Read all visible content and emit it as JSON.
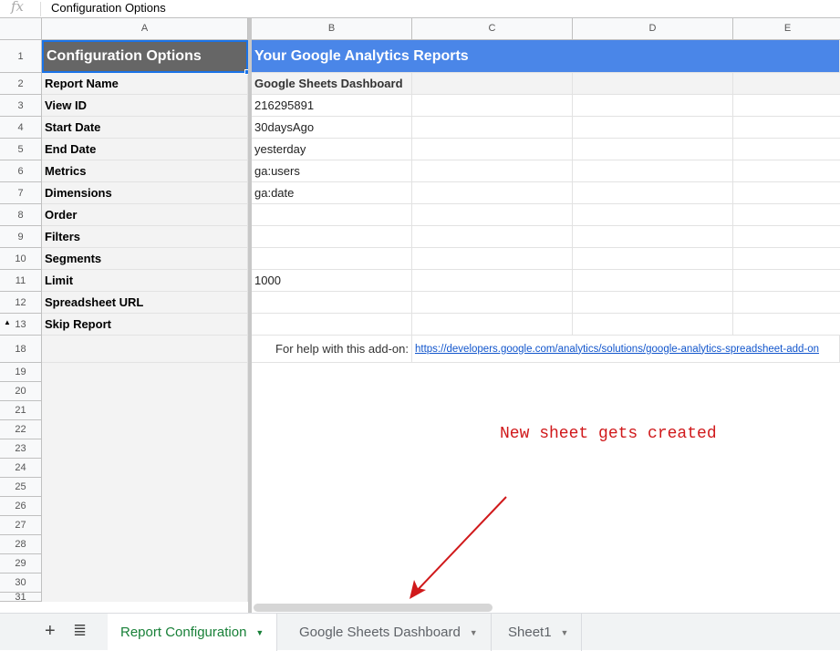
{
  "formula_bar": {
    "fx_label": "fx",
    "value": "Configuration Options"
  },
  "columns": [
    "A",
    "B",
    "C",
    "D",
    "E"
  ],
  "rows": [
    {
      "num": "1",
      "a": "Configuration Options",
      "b": "Your Google Analytics Reports"
    },
    {
      "num": "2",
      "a": "Report Name",
      "b": "Google Sheets Dashboard"
    },
    {
      "num": "3",
      "a": "View ID",
      "b": "216295891"
    },
    {
      "num": "4",
      "a": "Start Date",
      "b": "30daysAgo"
    },
    {
      "num": "5",
      "a": "End Date",
      "b": "yesterday"
    },
    {
      "num": "6",
      "a": "Metrics",
      "b": "ga:users"
    },
    {
      "num": "7",
      "a": "Dimensions",
      "b": "ga:date"
    },
    {
      "num": "8",
      "a": "Order",
      "b": ""
    },
    {
      "num": "9",
      "a": "Filters",
      "b": ""
    },
    {
      "num": "10",
      "a": "Segments",
      "b": ""
    },
    {
      "num": "11",
      "a": "Limit",
      "b": "1000"
    },
    {
      "num": "12",
      "a": "Spreadsheet URL",
      "b": ""
    },
    {
      "num": "13",
      "a": "Skip Report",
      "b": ""
    }
  ],
  "help_row": {
    "num": "18",
    "label": "For help with this add-on:",
    "link": "https://developers.google.com/analytics/solutions/google-analytics-spreadsheet-add-on"
  },
  "empty_rows": [
    "19",
    "20",
    "21",
    "22",
    "23",
    "24",
    "25",
    "26",
    "27",
    "28",
    "29",
    "30",
    "31"
  ],
  "annotation": {
    "text": "New sheet gets created",
    "color": "#d0191b"
  },
  "colors": {
    "header_a": "#666666",
    "header_b": "#4a86e8",
    "active_tab": "#188038",
    "link": "#1155cc"
  },
  "sheet_tabs": [
    {
      "label": "Report Configuration",
      "active": true
    },
    {
      "label": "Google Sheets Dashboard",
      "active": false
    },
    {
      "label": "Sheet1",
      "active": false
    }
  ],
  "toolbar": {
    "add_sheet": "+",
    "all_sheets": "≣"
  }
}
